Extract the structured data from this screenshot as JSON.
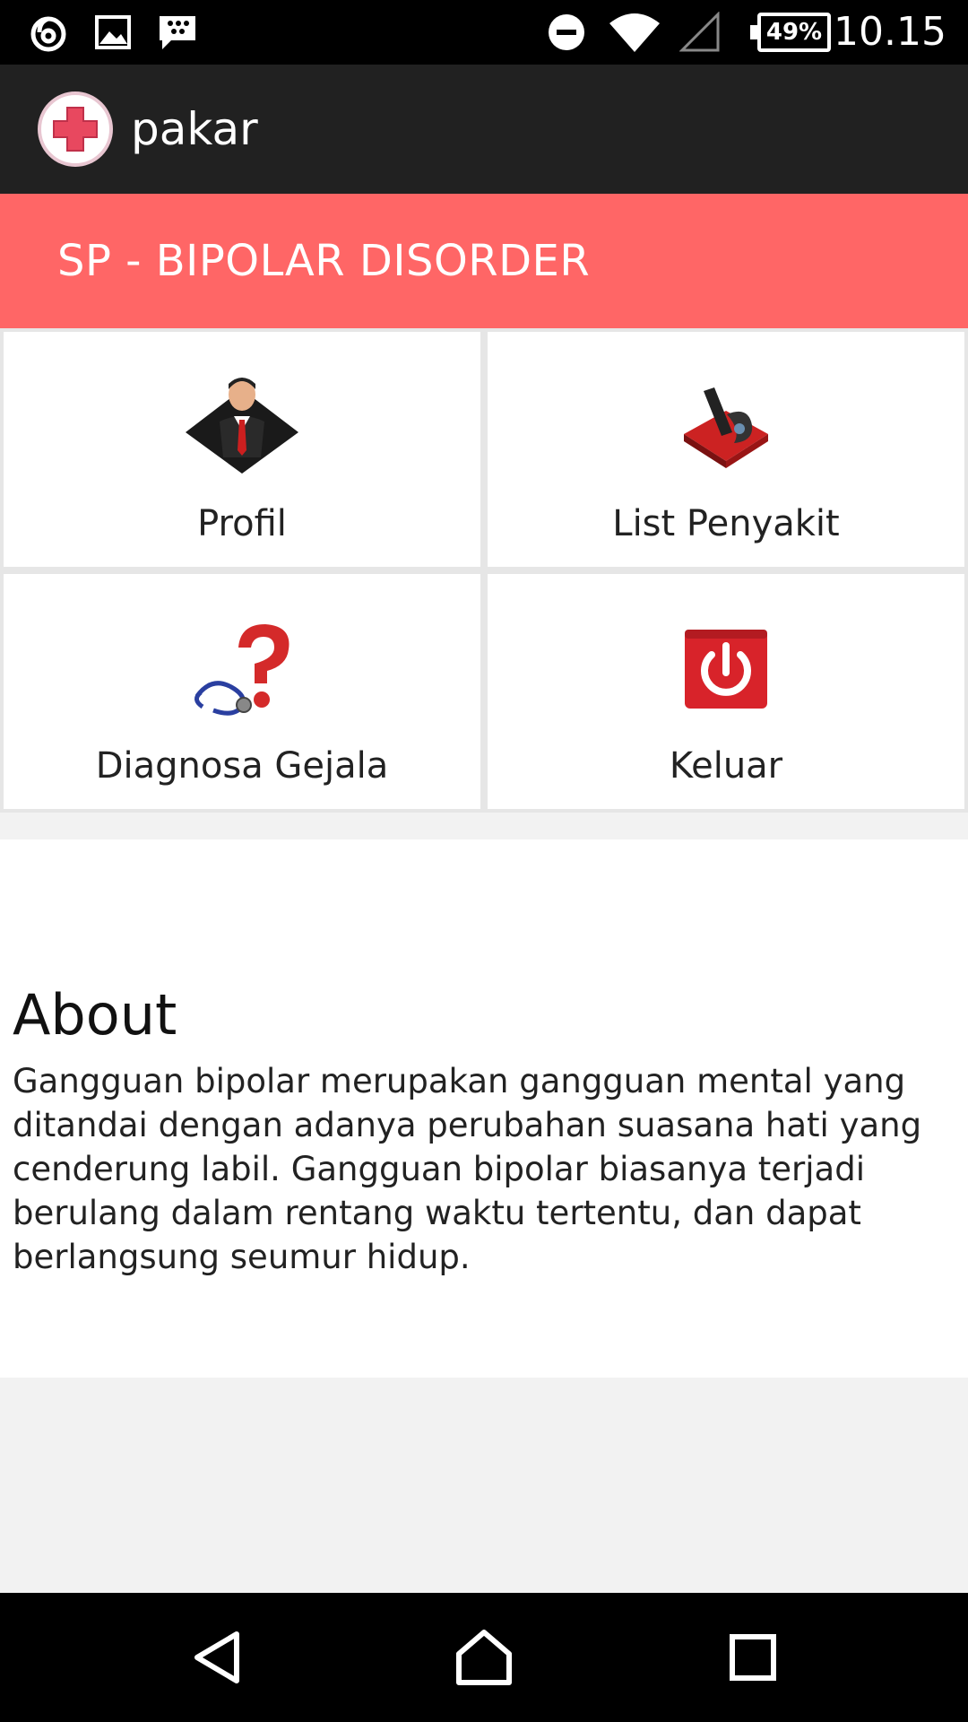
{
  "status_bar": {
    "time": "10.15",
    "battery": "49%",
    "icons": [
      "vodafone-icon",
      "image-icon",
      "bbm-icon",
      "dnd-icon",
      "wifi-icon",
      "signal-icon",
      "battery-icon"
    ]
  },
  "action_bar": {
    "title": "pakar",
    "logo_icon": "red-cross-icon"
  },
  "header": {
    "title": "SP - BIPOLAR DISORDER",
    "color": "#ff6666"
  },
  "menu": {
    "items": [
      {
        "label": "Profil",
        "icon": "businessman-icon"
      },
      {
        "label": "List Penyakit",
        "icon": "checklist-icon"
      },
      {
        "label": "Diagnosa Gejala",
        "icon": "stethoscope-question-icon"
      },
      {
        "label": "Keluar",
        "icon": "power-icon"
      }
    ]
  },
  "about": {
    "title": "About",
    "text": "Gangguan bipolar merupakan gangguan mental yang ditandai dengan adanya perubahan suasana hati yang cenderung labil. Gangguan bipolar biasanya terjadi berulang dalam rentang waktu tertentu, dan dapat berlangsung seumur hidup."
  },
  "nav_bar": {
    "buttons": [
      "back-icon",
      "home-icon",
      "recents-icon"
    ]
  }
}
